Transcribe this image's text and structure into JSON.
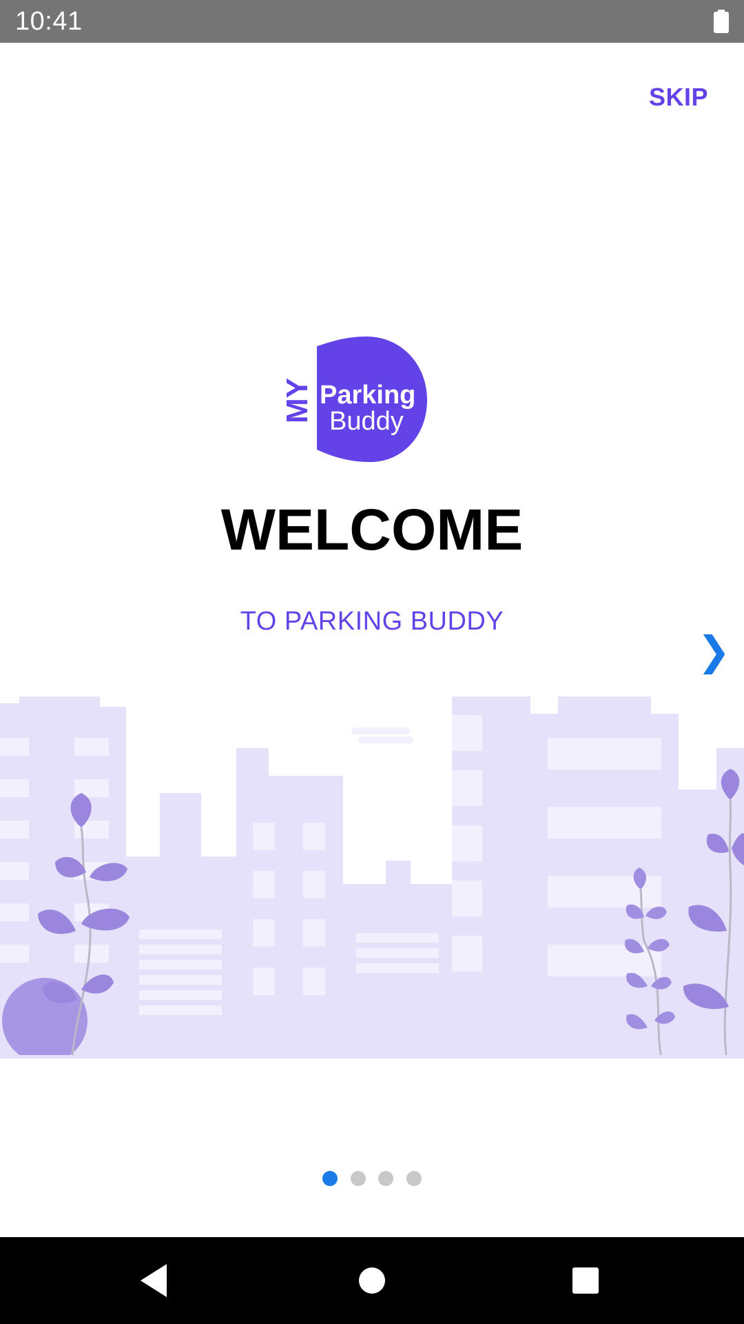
{
  "status_bar": {
    "time": "10:41",
    "battery_icon": "battery-full-icon"
  },
  "onboarding": {
    "skip_label": "SKIP",
    "logo": {
      "my": "MY",
      "line1": "Parking",
      "line2": "Buddy",
      "color": "#6342e8"
    },
    "title": "WELCOME",
    "subtitle": "TO PARKING BUDDY",
    "next_icon": "chevron-right-icon",
    "accent_color": "#6342e8",
    "pager": {
      "total": 4,
      "active": 1,
      "active_color": "#1a7ae8"
    }
  },
  "nav_bar": {
    "back_icon": "back-icon",
    "home_icon": "home-icon",
    "recents_icon": "recents-icon"
  }
}
